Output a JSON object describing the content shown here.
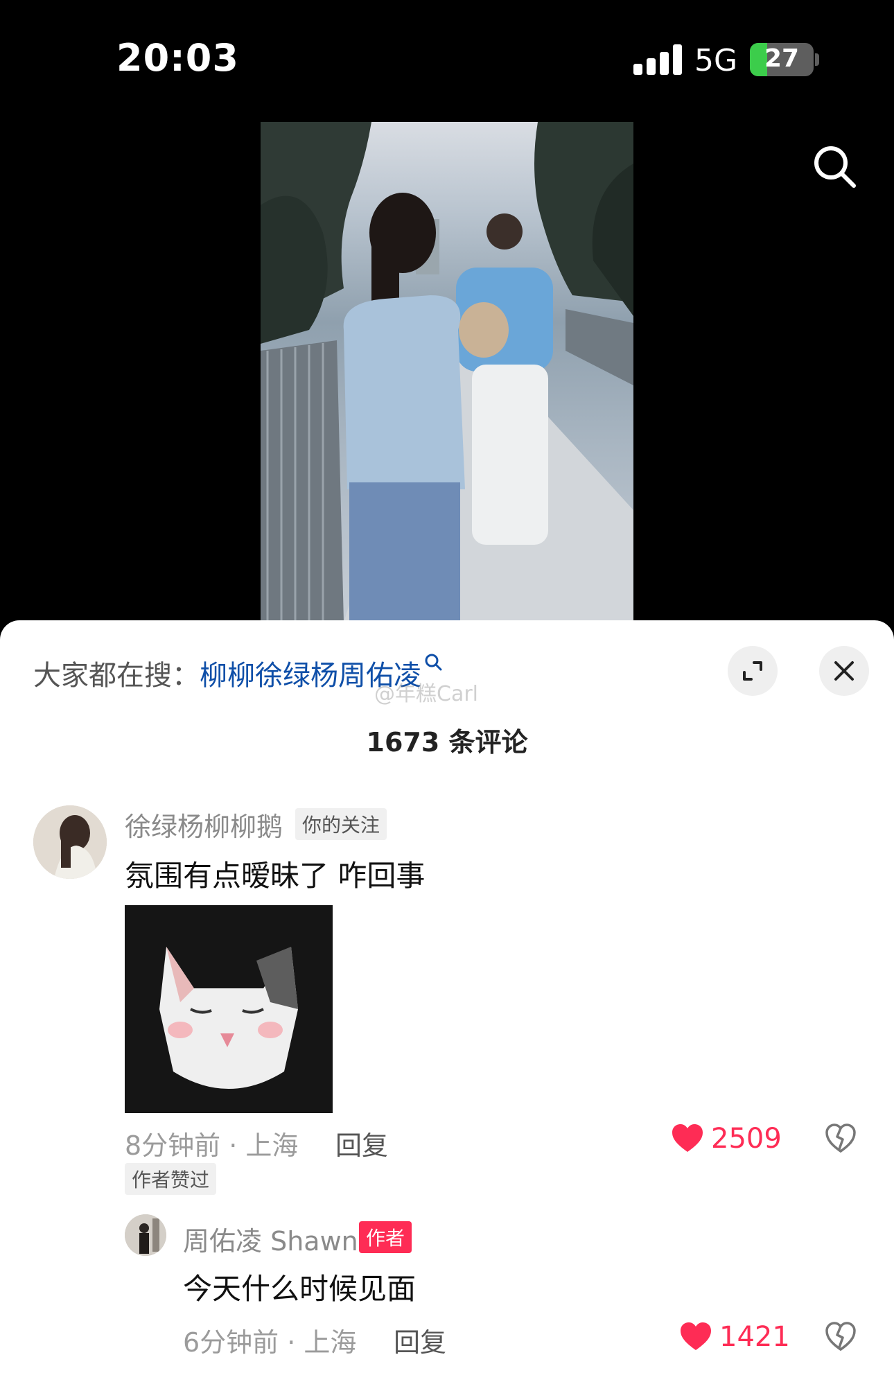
{
  "status_bar": {
    "time": "20:03",
    "network": "5G",
    "battery": "27",
    "battery_level": 0.27
  },
  "search_suggestion": {
    "prefix": "大家都在搜：",
    "keyword": "柳柳徐绿杨周佑凌"
  },
  "watermark": "@年糕Carl",
  "comment_count": "1673 条评论",
  "comments": [
    {
      "username": "徐绿杨柳柳鹅",
      "tag": "你的关注",
      "text": "氛围有点暧昧了 咋回事",
      "meta": "8分钟前 · 上海",
      "reply_label": "回复",
      "likes": "2509",
      "badge": "作者赞过"
    },
    {
      "username": "周佑凌 Shawn",
      "tag": "作者",
      "text": "今天什么时候见面",
      "meta": "6分钟前 · 上海",
      "reply_label": "回复",
      "likes": "1421"
    }
  ],
  "icons": {
    "search": "search-icon",
    "expand": "expand-icon",
    "close": "close-icon",
    "like": "heart-icon",
    "dislike": "broken-heart-icon"
  },
  "colors": {
    "accent": "#fe2c55",
    "link": "#0f4fa8",
    "sheet": "#ffffff"
  }
}
